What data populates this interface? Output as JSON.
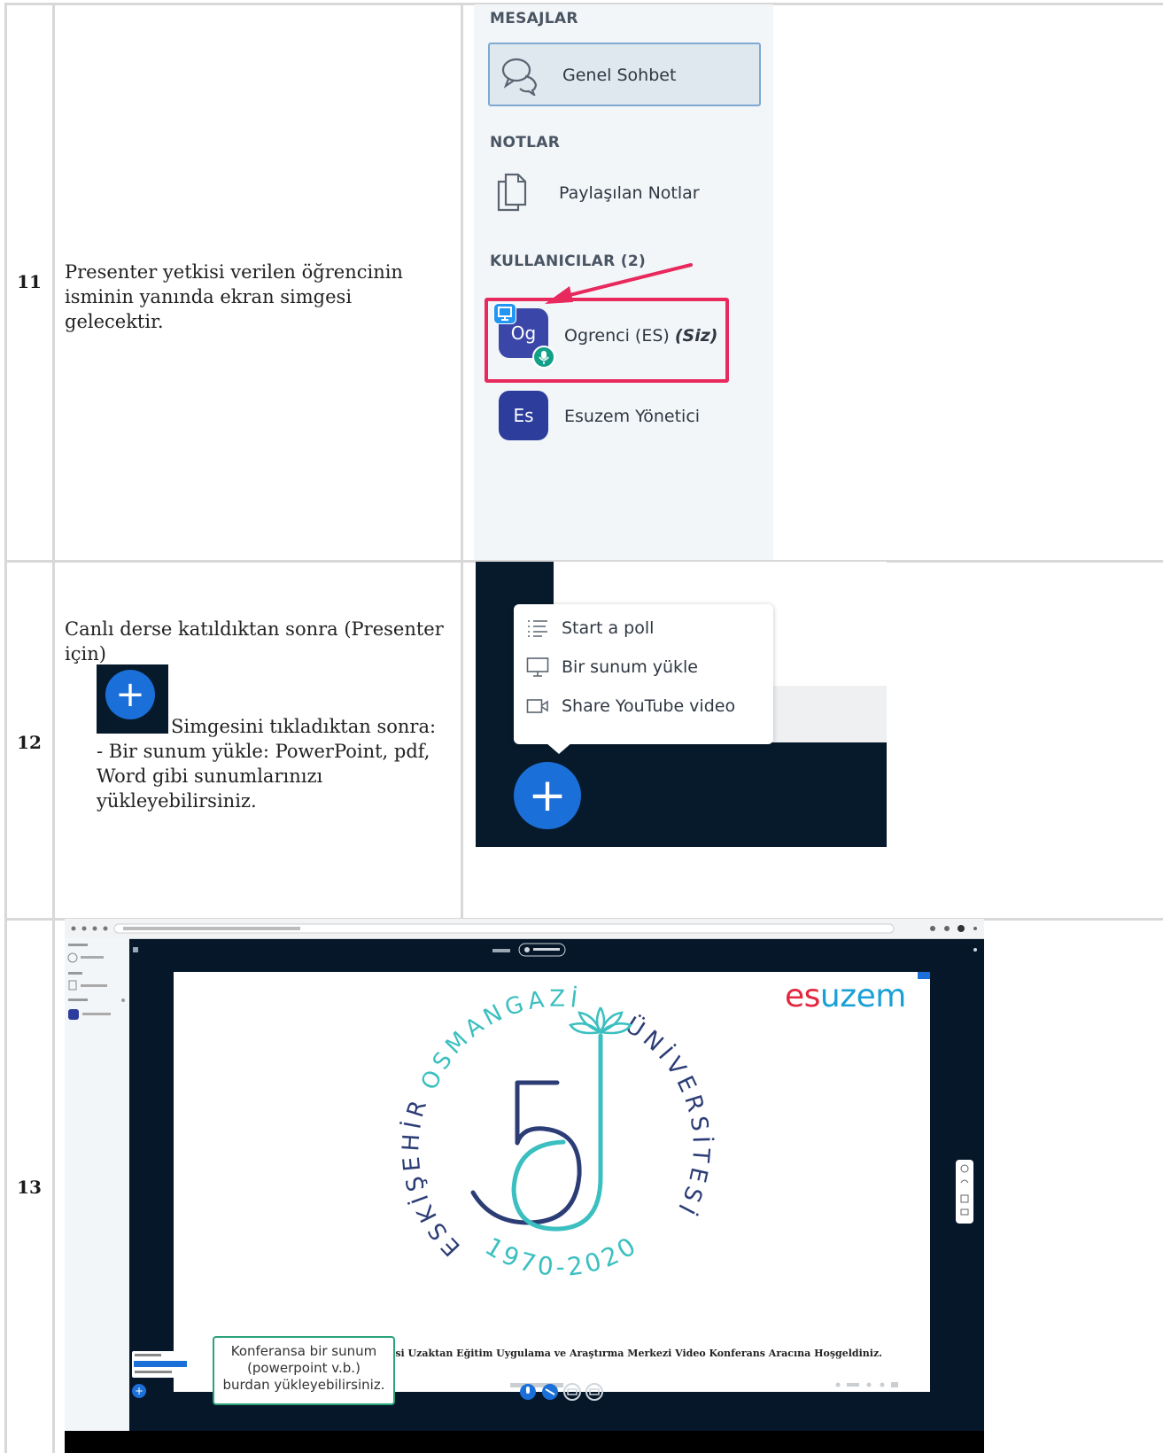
{
  "rows": [
    {
      "number": "11",
      "text_lines": [
        "Presenter yetkisi verilen öğrencinin",
        "isminin yanında ekran simgesi gelecektir."
      ]
    },
    {
      "number": "12",
      "text_lines": [
        "Canlı derse katıldıktan sonra (Presenter",
        "için)"
      ],
      "after_icon": "Simgesini tıkladıktan sonra:",
      "bullet_lines": [
        "- Bir sunum yükle: PowerPoint, pdf,",
        "Word gibi sunumlarınızı",
        "yükleyebilirsiniz."
      ]
    },
    {
      "number": "13"
    }
  ],
  "sidebar": {
    "messages_title": "MESAJLAR",
    "chat_label": "Genel Sohbet",
    "notes_title": "NOTLAR",
    "notes_label": "Paylaşılan Notlar",
    "users_title": "KULLANICILAR (2)",
    "users": [
      {
        "initials": "Og",
        "name": "Ogrenci (ES)",
        "you": "(Siz)",
        "color": "#3b47a8"
      },
      {
        "initials": "Es",
        "name": "Esuzem Yönetici",
        "color": "#2c3d9c"
      }
    ],
    "highlight_color": "#e8295d"
  },
  "menu": {
    "items": [
      {
        "label": "Start a poll",
        "icon": "poll-list-icon"
      },
      {
        "label": "Bir sunum yükle",
        "icon": "presentation-icon"
      },
      {
        "label": "Share YouTube video",
        "icon": "video-camera-icon"
      }
    ],
    "plus": "+"
  },
  "slide": {
    "brand_es": "es",
    "brand_uzem": "uzem",
    "seal_top_left": "OSMANGAZİ",
    "seal_left": "ESKİŞEHİR",
    "seal_right": "ÜNİVERSİTESİ",
    "seal_years": "1970-2020",
    "welcome": "Eskişehir Osmangazi Üniversitesi Uzaktan Eğitim Uygulama ve Araştırma Merkezi Video Konferans Aracına Hoşgeldiniz.",
    "tooltip_lines": [
      "Konferansa bir sunum",
      "(powerpoint v.b.)",
      "burdan yükleyebilirsiniz."
    ]
  },
  "colors": {
    "brand_red": "#e2273f",
    "brand_blue": "#1aa0d6",
    "accent_blue": "#1b6fd8",
    "dark_bg": "#061a2c",
    "seal_teal": "#3bbfc0",
    "seal_navy": "#2c3d76"
  }
}
